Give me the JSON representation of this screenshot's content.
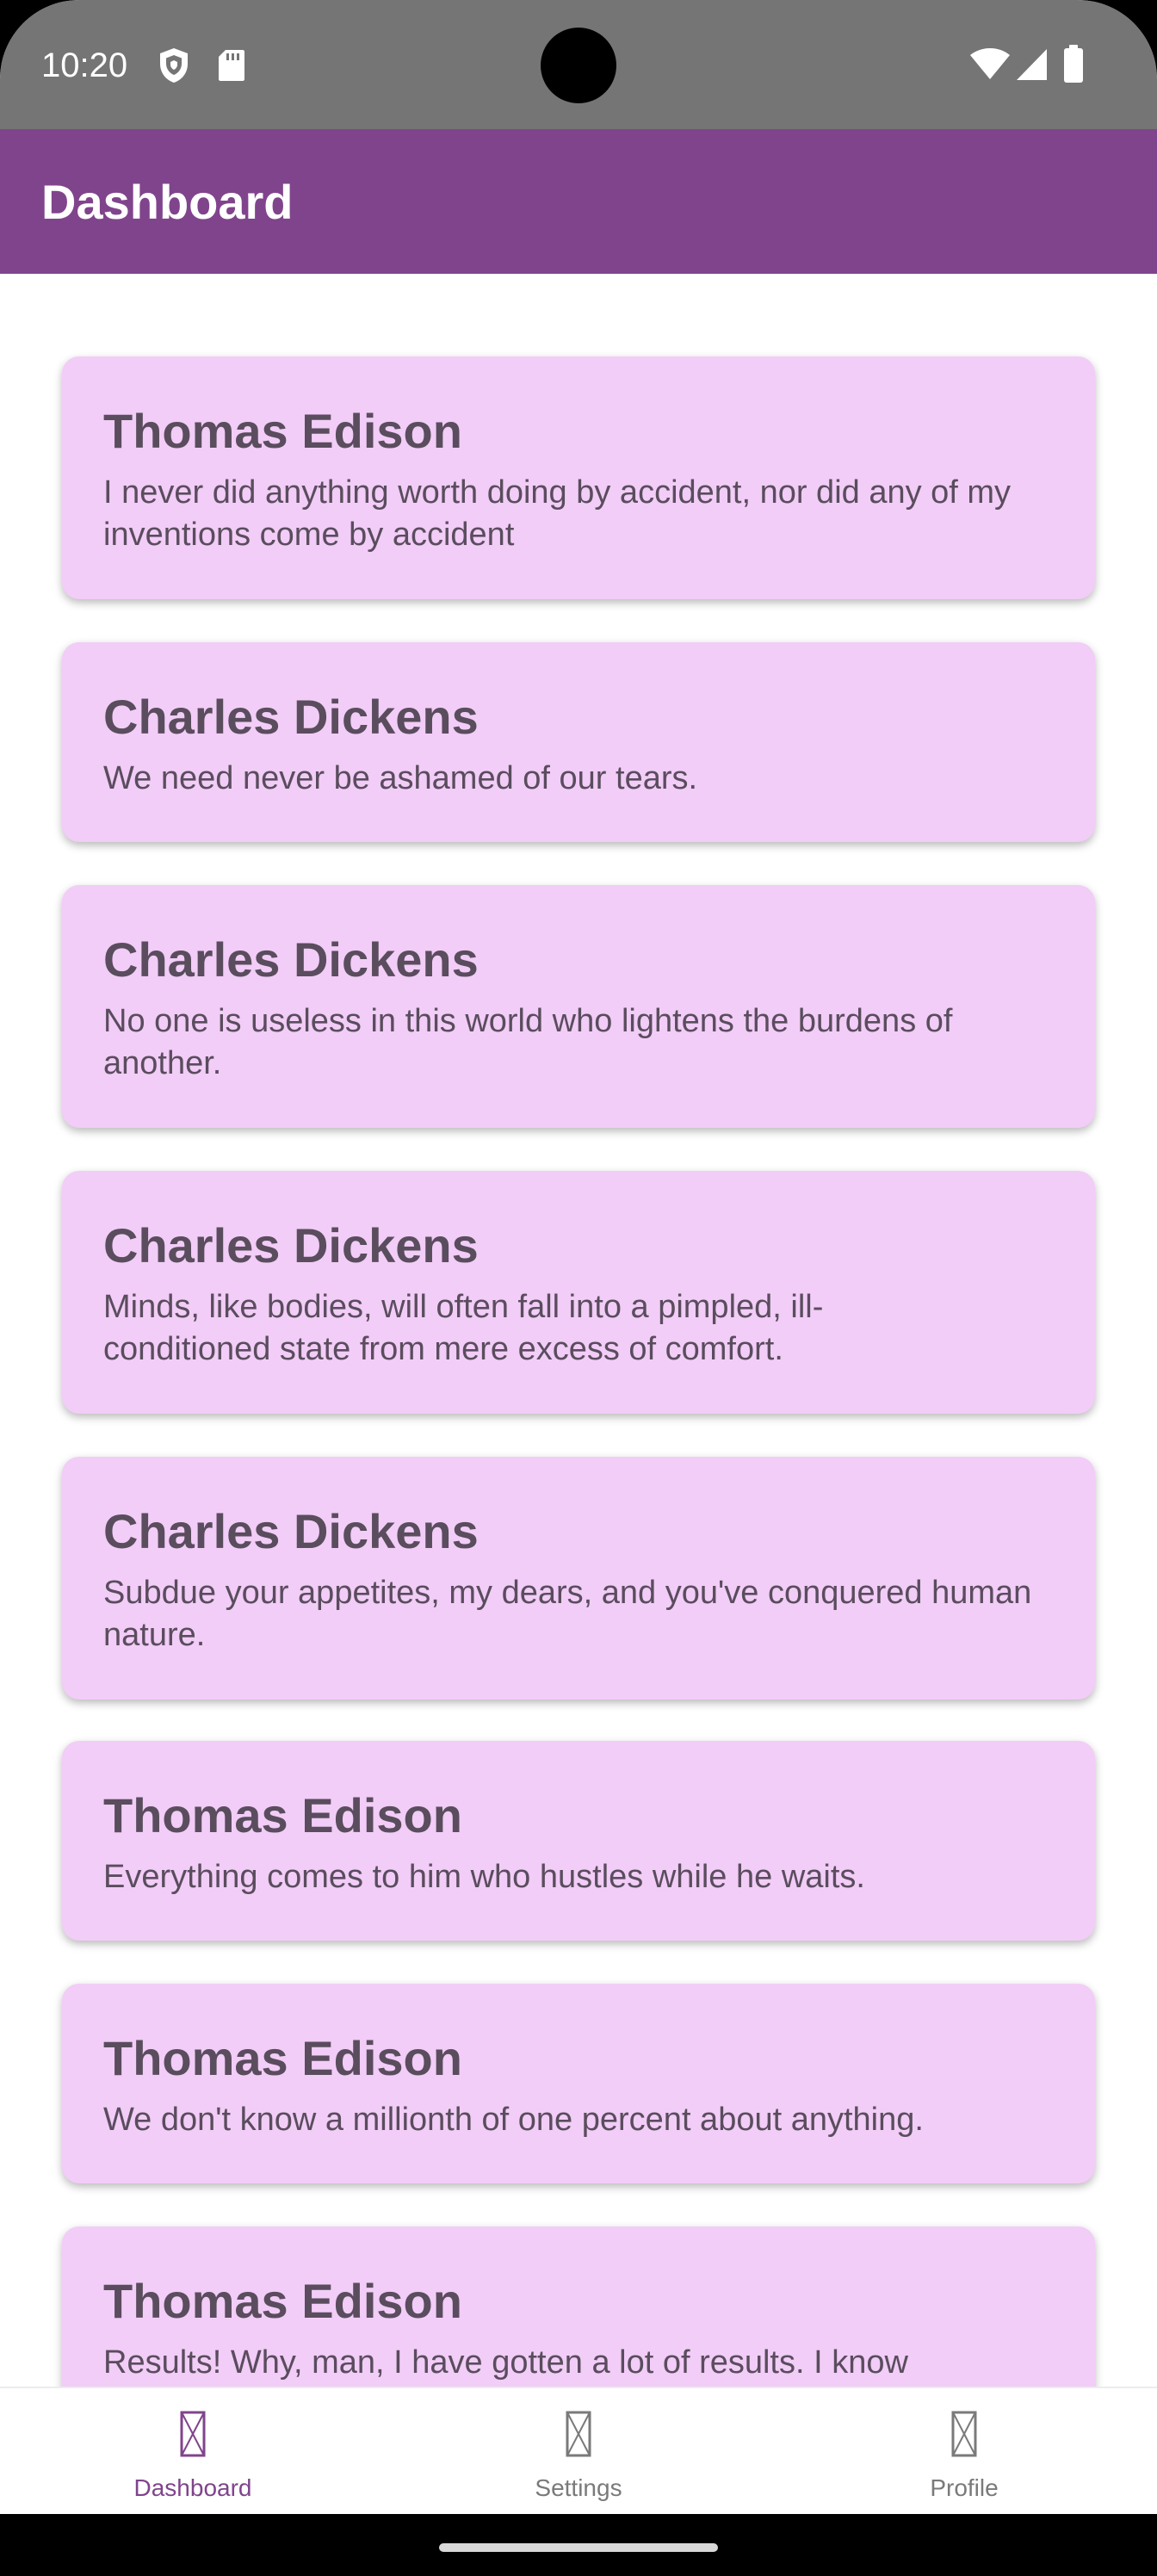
{
  "status_bar": {
    "time": "10:20",
    "left_icons": [
      "shield-icon",
      "sd-card-icon"
    ],
    "right_icons": [
      "wifi-icon",
      "signal-icon",
      "battery-icon"
    ]
  },
  "app_bar": {
    "title": "Dashboard",
    "color": "#80448c"
  },
  "quotes": [
    {
      "author": "Thomas Edison",
      "text": "I never did anything worth doing by accident, nor did any of my inventions come by accident"
    },
    {
      "author": "Charles Dickens",
      "text": "We need never be ashamed of our tears."
    },
    {
      "author": "Charles Dickens",
      "text": "No one is useless in this world who lightens the burdens of another."
    },
    {
      "author": "Charles Dickens",
      "text": "Minds, like bodies, will often fall into a pimpled, ill-conditioned state from mere excess of comfort."
    },
    {
      "author": "Charles Dickens",
      "text": "Subdue your appetites, my dears, and you've conquered human nature."
    },
    {
      "author": "Thomas Edison",
      "text": "Everything comes to him who hustles while he waits."
    },
    {
      "author": "Thomas Edison",
      "text": "We don't know a millionth of one percent about anything."
    },
    {
      "author": "Thomas Edison",
      "text": "Results! Why, man, I have gotten a lot of results. I know"
    }
  ],
  "card_color": "#f2cdf7",
  "bottom_nav": {
    "items": [
      {
        "label": "Dashboard",
        "icon": "placeholder-icon",
        "active": true
      },
      {
        "label": "Settings",
        "icon": "placeholder-icon",
        "active": false
      },
      {
        "label": "Profile",
        "icon": "placeholder-icon",
        "active": false
      }
    ],
    "active_color": "#80448c"
  }
}
